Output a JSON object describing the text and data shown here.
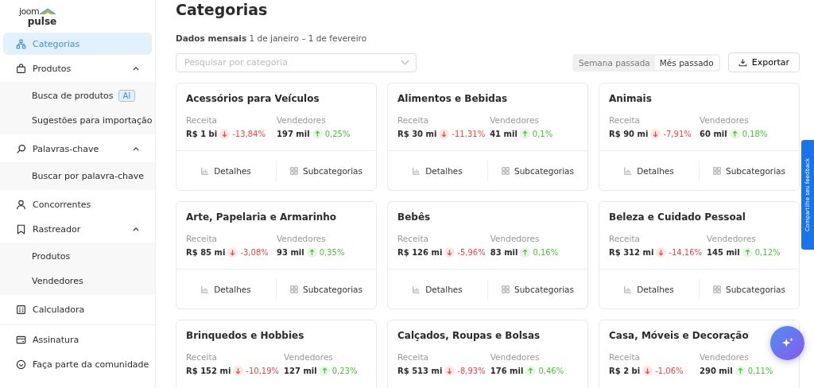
{
  "logo": {
    "top": "joom",
    "bottom": "pulse"
  },
  "sidebar": {
    "items": [
      {
        "kind": "item",
        "label": "Categorias",
        "selected": true
      },
      {
        "kind": "group",
        "label": "Produtos",
        "selected": false,
        "expanded": true,
        "children": [
          {
            "label": "Busca de produtos",
            "badge": "AI",
            "selected": false
          },
          {
            "label": "Sugestões para importação",
            "selected": false
          }
        ]
      },
      {
        "kind": "group",
        "label": "Palavras-chave",
        "selected": false,
        "expanded": true,
        "children": [
          {
            "label": "Buscar por palavra-chave",
            "selected": false
          }
        ]
      },
      {
        "kind": "item",
        "label": "Concorrentes",
        "selected": false
      },
      {
        "kind": "group",
        "label": "Rastreador",
        "selected": false,
        "expanded": true,
        "children": [
          {
            "label": "Produtos",
            "selected": false
          },
          {
            "label": "Vendedores",
            "selected": false
          }
        ]
      },
      {
        "kind": "item",
        "label": "Calculadora",
        "selected": false
      },
      {
        "kind": "divider"
      },
      {
        "kind": "item",
        "label": "Assinatura",
        "selected": false
      },
      {
        "kind": "item",
        "label": "Faça parte da comunidade",
        "selected": false
      }
    ]
  },
  "page": {
    "title": "Categorias",
    "period_label": "Dados mensais",
    "period": "1 de janeiro – 1 de fevereiro"
  },
  "search": {
    "placeholder": "Pesquisar por categoria"
  },
  "period_toggle": [
    {
      "label": "Semana passada",
      "selected": false
    },
    {
      "label": "Mês passado",
      "selected": true
    }
  ],
  "export_button": "Exportar",
  "cards": [
    {
      "title": "Acessórios para Veículos",
      "metrics": [
        {
          "label": "Receita",
          "value": "R$ 1 bi",
          "change": "-13,84%",
          "kind": "down"
        },
        {
          "label": "Vendedores",
          "value": "197 mil",
          "change": "0,25%",
          "kind": "up"
        }
      ],
      "actions": [
        {
          "kind": "details",
          "label": "Detalhes"
        },
        {
          "kind": "subcategories",
          "label": "Subcategorias"
        }
      ]
    },
    {
      "title": "Alimentos e Bebidas",
      "metrics": [
        {
          "label": "Receita",
          "value": "R$ 30 mi",
          "change": "-11,31%",
          "kind": "down"
        },
        {
          "label": "Vendedores",
          "value": "41 mil",
          "change": "0,1%",
          "kind": "up"
        }
      ],
      "actions": [
        {
          "kind": "details",
          "label": "Detalhes"
        },
        {
          "kind": "subcategories",
          "label": "Subcategorias"
        }
      ]
    },
    {
      "title": "Animais",
      "metrics": [
        {
          "label": "Receita",
          "value": "R$ 90 mi",
          "change": "-7,91%",
          "kind": "down"
        },
        {
          "label": "Vendedores",
          "value": "60 mil",
          "change": "0,18%",
          "kind": "up"
        }
      ],
      "actions": [
        {
          "kind": "details",
          "label": "Detalhes"
        },
        {
          "kind": "subcategories",
          "label": "Subcategorias"
        }
      ]
    },
    {
      "title": "Arte, Papelaria e Armarinho",
      "metrics": [
        {
          "label": "Receita",
          "value": "R$ 85 mi",
          "change": "-3,08%",
          "kind": "down"
        },
        {
          "label": "Vendedores",
          "value": "93 mil",
          "change": "0,35%",
          "kind": "up"
        }
      ],
      "actions": [
        {
          "kind": "details",
          "label": "Detalhes"
        },
        {
          "kind": "subcategories",
          "label": "Subcategorias"
        }
      ]
    },
    {
      "title": "Bebês",
      "metrics": [
        {
          "label": "Receita",
          "value": "R$ 126 mi",
          "change": "-5,96%",
          "kind": "down"
        },
        {
          "label": "Vendedores",
          "value": "83 mil",
          "change": "0,16%",
          "kind": "up"
        }
      ],
      "actions": [
        {
          "kind": "details",
          "label": "Detalhes"
        },
        {
          "kind": "subcategories",
          "label": "Subcategorias"
        }
      ]
    },
    {
      "title": "Beleza e Cuidado Pessoal",
      "metrics": [
        {
          "label": "Receita",
          "value": "R$ 312 mi",
          "change": "-14,16%",
          "kind": "down"
        },
        {
          "label": "Vendedores",
          "value": "145 mil",
          "change": "0,12%",
          "kind": "up"
        }
      ],
      "actions": [
        {
          "kind": "details",
          "label": "Detalhes"
        },
        {
          "kind": "subcategories",
          "label": "Subcategorias"
        }
      ]
    },
    {
      "title": "Brinquedos e Hobbies",
      "metrics": [
        {
          "label": "Receita",
          "value": "R$ 152 mi",
          "change": "-10,19%",
          "kind": "down"
        },
        {
          "label": "Vendedores",
          "value": "127 mil",
          "change": "0,23%",
          "kind": "up"
        }
      ]
    },
    {
      "title": "Calçados, Roupas e Bolsas",
      "metrics": [
        {
          "label": "Receita",
          "value": "R$ 513 mi",
          "change": "-8,93%",
          "kind": "down"
        },
        {
          "label": "Vendedores",
          "value": "176 mil",
          "change": "0,46%",
          "kind": "up"
        }
      ]
    },
    {
      "title": "Casa, Móveis e Decoração",
      "metrics": [
        {
          "label": "Receita",
          "value": "R$ 2 bi",
          "change": "-1,06%",
          "kind": "down"
        },
        {
          "label": "Vendedores",
          "value": "290 mil",
          "change": "0,11%",
          "kind": "up"
        }
      ]
    }
  ],
  "feedback_tab": "Compartilhe seu feedback"
}
